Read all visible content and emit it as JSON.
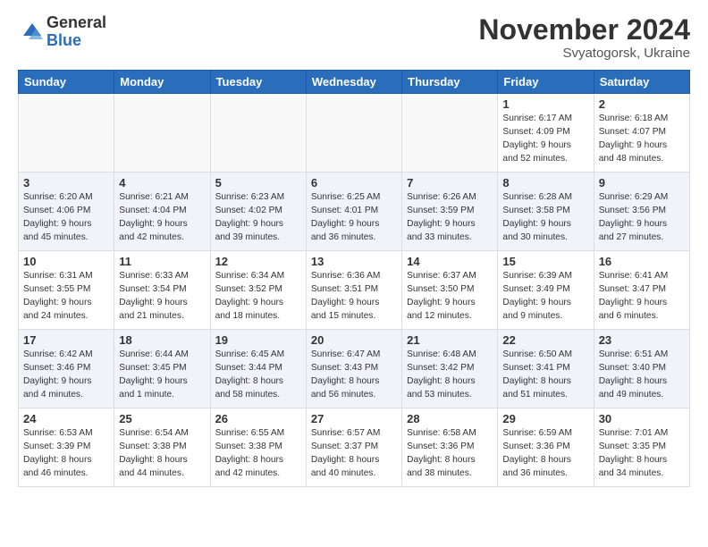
{
  "header": {
    "logo_general": "General",
    "logo_blue": "Blue",
    "month_title": "November 2024",
    "location": "Svyatogorsk, Ukraine"
  },
  "weekdays": [
    "Sunday",
    "Monday",
    "Tuesday",
    "Wednesday",
    "Thursday",
    "Friday",
    "Saturday"
  ],
  "weeks": [
    [
      {
        "day": "",
        "info": ""
      },
      {
        "day": "",
        "info": ""
      },
      {
        "day": "",
        "info": ""
      },
      {
        "day": "",
        "info": ""
      },
      {
        "day": "",
        "info": ""
      },
      {
        "day": "1",
        "info": "Sunrise: 6:17 AM\nSunset: 4:09 PM\nDaylight: 9 hours\nand 52 minutes."
      },
      {
        "day": "2",
        "info": "Sunrise: 6:18 AM\nSunset: 4:07 PM\nDaylight: 9 hours\nand 48 minutes."
      }
    ],
    [
      {
        "day": "3",
        "info": "Sunrise: 6:20 AM\nSunset: 4:06 PM\nDaylight: 9 hours\nand 45 minutes."
      },
      {
        "day": "4",
        "info": "Sunrise: 6:21 AM\nSunset: 4:04 PM\nDaylight: 9 hours\nand 42 minutes."
      },
      {
        "day": "5",
        "info": "Sunrise: 6:23 AM\nSunset: 4:02 PM\nDaylight: 9 hours\nand 39 minutes."
      },
      {
        "day": "6",
        "info": "Sunrise: 6:25 AM\nSunset: 4:01 PM\nDaylight: 9 hours\nand 36 minutes."
      },
      {
        "day": "7",
        "info": "Sunrise: 6:26 AM\nSunset: 3:59 PM\nDaylight: 9 hours\nand 33 minutes."
      },
      {
        "day": "8",
        "info": "Sunrise: 6:28 AM\nSunset: 3:58 PM\nDaylight: 9 hours\nand 30 minutes."
      },
      {
        "day": "9",
        "info": "Sunrise: 6:29 AM\nSunset: 3:56 PM\nDaylight: 9 hours\nand 27 minutes."
      }
    ],
    [
      {
        "day": "10",
        "info": "Sunrise: 6:31 AM\nSunset: 3:55 PM\nDaylight: 9 hours\nand 24 minutes."
      },
      {
        "day": "11",
        "info": "Sunrise: 6:33 AM\nSunset: 3:54 PM\nDaylight: 9 hours\nand 21 minutes."
      },
      {
        "day": "12",
        "info": "Sunrise: 6:34 AM\nSunset: 3:52 PM\nDaylight: 9 hours\nand 18 minutes."
      },
      {
        "day": "13",
        "info": "Sunrise: 6:36 AM\nSunset: 3:51 PM\nDaylight: 9 hours\nand 15 minutes."
      },
      {
        "day": "14",
        "info": "Sunrise: 6:37 AM\nSunset: 3:50 PM\nDaylight: 9 hours\nand 12 minutes."
      },
      {
        "day": "15",
        "info": "Sunrise: 6:39 AM\nSunset: 3:49 PM\nDaylight: 9 hours\nand 9 minutes."
      },
      {
        "day": "16",
        "info": "Sunrise: 6:41 AM\nSunset: 3:47 PM\nDaylight: 9 hours\nand 6 minutes."
      }
    ],
    [
      {
        "day": "17",
        "info": "Sunrise: 6:42 AM\nSunset: 3:46 PM\nDaylight: 9 hours\nand 4 minutes."
      },
      {
        "day": "18",
        "info": "Sunrise: 6:44 AM\nSunset: 3:45 PM\nDaylight: 9 hours\nand 1 minute."
      },
      {
        "day": "19",
        "info": "Sunrise: 6:45 AM\nSunset: 3:44 PM\nDaylight: 8 hours\nand 58 minutes."
      },
      {
        "day": "20",
        "info": "Sunrise: 6:47 AM\nSunset: 3:43 PM\nDaylight: 8 hours\nand 56 minutes."
      },
      {
        "day": "21",
        "info": "Sunrise: 6:48 AM\nSunset: 3:42 PM\nDaylight: 8 hours\nand 53 minutes."
      },
      {
        "day": "22",
        "info": "Sunrise: 6:50 AM\nSunset: 3:41 PM\nDaylight: 8 hours\nand 51 minutes."
      },
      {
        "day": "23",
        "info": "Sunrise: 6:51 AM\nSunset: 3:40 PM\nDaylight: 8 hours\nand 49 minutes."
      }
    ],
    [
      {
        "day": "24",
        "info": "Sunrise: 6:53 AM\nSunset: 3:39 PM\nDaylight: 8 hours\nand 46 minutes."
      },
      {
        "day": "25",
        "info": "Sunrise: 6:54 AM\nSunset: 3:38 PM\nDaylight: 8 hours\nand 44 minutes."
      },
      {
        "day": "26",
        "info": "Sunrise: 6:55 AM\nSunset: 3:38 PM\nDaylight: 8 hours\nand 42 minutes."
      },
      {
        "day": "27",
        "info": "Sunrise: 6:57 AM\nSunset: 3:37 PM\nDaylight: 8 hours\nand 40 minutes."
      },
      {
        "day": "28",
        "info": "Sunrise: 6:58 AM\nSunset: 3:36 PM\nDaylight: 8 hours\nand 38 minutes."
      },
      {
        "day": "29",
        "info": "Sunrise: 6:59 AM\nSunset: 3:36 PM\nDaylight: 8 hours\nand 36 minutes."
      },
      {
        "day": "30",
        "info": "Sunrise: 7:01 AM\nSunset: 3:35 PM\nDaylight: 8 hours\nand 34 minutes."
      }
    ]
  ]
}
